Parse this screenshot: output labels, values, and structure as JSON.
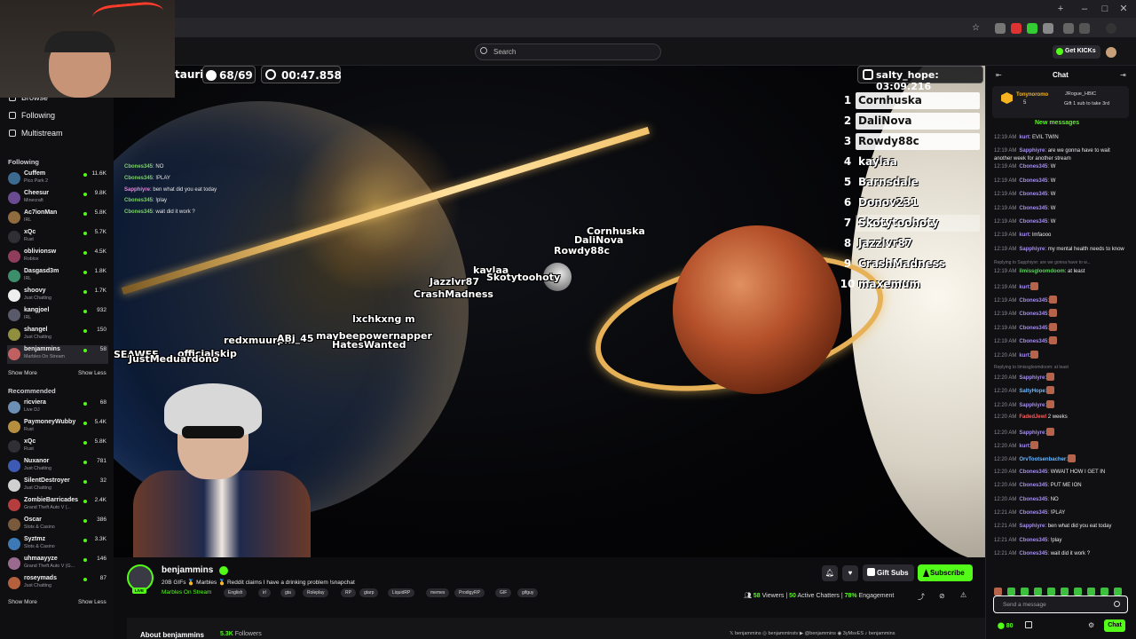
{
  "search": {
    "placeholder": "Search"
  },
  "header": {
    "get_kicks": "Get KICKs"
  },
  "sidebar": {
    "nav": [
      {
        "label": "Browse"
      },
      {
        "label": "Following"
      },
      {
        "label": "Multistream"
      }
    ],
    "following_title": "Following",
    "following": [
      {
        "name": "Cuffem",
        "game": "Pico Park 2",
        "viewers": "11.6K",
        "color": "#3d6b8f"
      },
      {
        "name": "Cheesur",
        "game": "Minecraft",
        "viewers": "9.8K",
        "color": "#6b4b8f"
      },
      {
        "name": "Ac7ionMan",
        "game": "IRL",
        "viewers": "5.8K",
        "color": "#8f6b3d"
      },
      {
        "name": "xQc",
        "game": "Rust",
        "viewers": "5.7K",
        "color": "#2f2f35"
      },
      {
        "name": "oblivionsw",
        "game": "Roblox",
        "viewers": "4.5K",
        "color": "#8f3d5a"
      },
      {
        "name": "Dasgasd3m",
        "game": "IRL",
        "viewers": "1.8K",
        "color": "#3d8f6b"
      },
      {
        "name": "shoovy",
        "game": "Just Chatting",
        "viewers": "1.7K",
        "color": "#eeeeee"
      },
      {
        "name": "kangjoel",
        "game": "IRL",
        "viewers": "932",
        "color": "#5a5a6a"
      },
      {
        "name": "shangel",
        "game": "Just Chatting",
        "viewers": "150",
        "color": "#8f8f3d"
      },
      {
        "name": "benjammins",
        "game": "Marbles On Stream",
        "viewers": "58",
        "color": "#c06060"
      }
    ],
    "show_more": "Show More",
    "show_less": "Show Less",
    "recommended_title": "Recommended",
    "recommended": [
      {
        "name": "ricviera",
        "game": "Live DJ",
        "viewers": "68",
        "color": "#6b8fb5"
      },
      {
        "name": "PaymoneyWubby",
        "game": "Rust",
        "viewers": "5.4K",
        "color": "#b58f3d"
      },
      {
        "name": "xQc",
        "game": "Rust",
        "viewers": "5.8K",
        "color": "#2f2f35"
      },
      {
        "name": "Nuxanor",
        "game": "Just Chatting",
        "viewers": "781",
        "color": "#3d5ab5"
      },
      {
        "name": "SilentDestroyer",
        "game": "Just Chatting",
        "viewers": "32",
        "color": "#d0d0d0"
      },
      {
        "name": "ZombieBarricades",
        "game": "Grand Theft Auto V (...",
        "viewers": "2.4K",
        "color": "#b53d3d"
      },
      {
        "name": "Oscar",
        "game": "Slots & Casino",
        "viewers": "386",
        "color": "#7a5a3d"
      },
      {
        "name": "Syztmz",
        "game": "Slots & Casino",
        "viewers": "3.3K",
        "color": "#3d7ab5"
      },
      {
        "name": "uhmaayyze",
        "game": "Grand Theft Auto V (G...",
        "viewers": "146",
        "color": "#9a6b8f"
      },
      {
        "name": "roseymads",
        "game": "Just Chatting",
        "viewers": "87",
        "color": "#b5603d"
      }
    ]
  },
  "video": {
    "hud_left": "tauri",
    "hud_count": "68/69",
    "hud_timer": "00:47.858",
    "hud_right": "salty_hope: 03:09.216",
    "leaderboard": [
      {
        "rank": "1",
        "name": "Cornhuska"
      },
      {
        "rank": "2",
        "name": "DaliNova"
      },
      {
        "rank": "3",
        "name": "Rowdy88c"
      },
      {
        "rank": "4",
        "name": "kaylaa"
      },
      {
        "rank": "5",
        "name": "Barnsdale"
      },
      {
        "rank": "6",
        "name": "Donov231"
      },
      {
        "rank": "7",
        "name": "Skotytoohoty"
      },
      {
        "rank": "8",
        "name": "Jazzlvr87"
      },
      {
        "rank": "9",
        "name": "CrashMadness"
      },
      {
        "rank": "10",
        "name": "maxemum"
      }
    ],
    "marble_labels": [
      "Cornhuska",
      "DaliNova",
      "Rowdy88c",
      "kaylaa",
      "Skotytoohoty",
      "Jazzlvr87",
      "CrashMadness",
      "lxchkxng m",
      "maybeepowernapper",
      "redxmuurph",
      "ABj_45",
      "HatesWanted",
      "SEAWEE",
      "officialskip",
      "JustMeduardono"
    ],
    "overlay_chat": [
      {
        "user": "Cbones345",
        "text": "NO"
      },
      {
        "user": "Cbones345",
        "text": "!PLAY"
      },
      {
        "user": "Sapphiyre",
        "text": "ben what did you eat today"
      },
      {
        "user": "Cbones345",
        "text": "!play"
      },
      {
        "user": "Cbones345",
        "text": "wait did it work ?"
      }
    ]
  },
  "stream": {
    "name": "benjammins",
    "live": "LIVE",
    "title": "20B GIFs 🥇 Marbles 🥇 Reddit claims I have a drinking problem !snapchat",
    "category": "Marbles On Stream",
    "tags": [
      "English",
      "irl",
      "gta",
      "Roleplay",
      "RP",
      "gtarp",
      "LiquidRP",
      "memes",
      "ProdigyRP",
      "GIF",
      "gifguy"
    ],
    "gift_subs": "Gift Subs",
    "subscribe": "Subscribe",
    "viewers_num": "58",
    "viewers_label": "Viewers",
    "chatters_num": "50",
    "chatters_label": "Active Chatters",
    "engagement_num": "78%",
    "engagement_label": "Engagement"
  },
  "about": {
    "title": "About benjammins",
    "followers_num": "5.3K",
    "followers_label": "Followers",
    "socials": "𝕏 benjammins   ◎ benjamminstv   ▶ @benjammins   ◉ 3yMsvES   ♪ benjammins"
  },
  "chat": {
    "title": "Chat",
    "pinned_user": "Tonynoromo",
    "pinned_count": "5",
    "pinned_gifter": "JRogue_HBIC",
    "pinned_text": "Gift 1 sub to take 3rd",
    "new_messages": "New messages",
    "messages": [
      {
        "time": "12:19 AM",
        "user": "kurt",
        "cls": "",
        "text": ": EVIL TWIN"
      },
      {
        "time": "12:19 AM",
        "user": "Sapphiyre",
        "cls": "",
        "text": ": are we gonna have to wait another week for another stream"
      },
      {
        "time": "12:19 AM",
        "user": "Cbones345",
        "cls": "",
        "text": ": W"
      },
      {
        "time": "12:19 AM",
        "user": "Cbones345",
        "cls": "",
        "text": ": W"
      },
      {
        "time": "12:19 AM",
        "user": "Cbones345",
        "cls": "",
        "text": ": W"
      },
      {
        "time": "12:19 AM",
        "user": "Cbones345",
        "cls": "",
        "text": ": W"
      },
      {
        "time": "12:19 AM",
        "user": "Cbones345",
        "cls": "",
        "text": ": W"
      },
      {
        "time": "12:19 AM",
        "user": "kurt",
        "cls": "",
        "text": ": lmfaooo"
      },
      {
        "time": "12:19 AM",
        "user": "Sapphiyre",
        "cls": "",
        "text": ": my mental health needs to know"
      },
      {
        "time": "12:19 AM",
        "user": "ilmissgloomdoom",
        "cls": "green",
        "text": ": at least",
        "reply": "Replying to Sapphiyre: are we gonna have to w..."
      },
      {
        "time": "12:19 AM",
        "user": "kurt",
        "cls": "",
        "text": ":"
      },
      {
        "time": "12:19 AM",
        "user": "Cbones345",
        "cls": "",
        "text": ":"
      },
      {
        "time": "12:19 AM",
        "user": "Cbones345",
        "cls": "",
        "text": ":"
      },
      {
        "time": "12:19 AM",
        "user": "Cbones345",
        "cls": "",
        "text": ":"
      },
      {
        "time": "12:19 AM",
        "user": "Cbones345",
        "cls": "",
        "text": ":"
      },
      {
        "time": "12:20 AM",
        "user": "kurt",
        "cls": "",
        "text": ":"
      },
      {
        "time": "12:20 AM",
        "user": "Sapphiyre",
        "cls": "",
        "text": ":",
        "reply": "Replying to ilmissgloomdoom: at least"
      },
      {
        "time": "12:20 AM",
        "user": "SaltyHope",
        "cls": "blue",
        "text": ":"
      },
      {
        "time": "12:20 AM",
        "user": "Sapphiyre",
        "cls": "",
        "text": ":"
      },
      {
        "time": "12:20 AM",
        "user": "FadedJewl",
        "cls": "red",
        "text": " 2 weeks"
      },
      {
        "time": "12:20 AM",
        "user": "Sapphiyre",
        "cls": "",
        "text": ":"
      },
      {
        "time": "12:20 AM",
        "user": "kurt",
        "cls": "",
        "text": ":"
      },
      {
        "time": "12:20 AM",
        "user": "OrvTootsenbacher",
        "cls": "blue",
        "text": ":"
      },
      {
        "time": "12:20 AM",
        "user": "Cbones345",
        "cls": "",
        "text": ": WWAIT HOW I GET IN"
      },
      {
        "time": "12:20 AM",
        "user": "Cbones345",
        "cls": "",
        "text": ": PUT ME ION"
      },
      {
        "time": "12:20 AM",
        "user": "Cbones345",
        "cls": "",
        "text": ": NO"
      },
      {
        "time": "12:21 AM",
        "user": "Cbones345",
        "cls": "",
        "text": ": !PLAY"
      },
      {
        "time": "12:21 AM",
        "user": "Sapphiyre",
        "cls": "",
        "text": ": ben what did you eat today"
      },
      {
        "time": "12:21 AM",
        "user": "Cbones345",
        "cls": "",
        "text": ": !play"
      },
      {
        "time": "12:21 AM",
        "user": "Cbones345",
        "cls": "",
        "text": ": wait did it work ?"
      }
    ],
    "input_placeholder": "Send a message",
    "kicks": "80",
    "send": "Chat"
  },
  "colors": {
    "accent": "#53fc18",
    "background": "#0b0b0e"
  }
}
